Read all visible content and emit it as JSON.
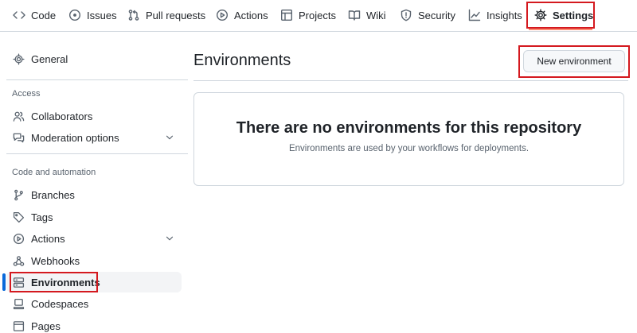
{
  "nav": {
    "tabs": [
      {
        "label": "Code",
        "icon": "code-icon"
      },
      {
        "label": "Issues",
        "icon": "issue-opened-icon"
      },
      {
        "label": "Pull requests",
        "icon": "git-pull-request-icon"
      },
      {
        "label": "Actions",
        "icon": "play-icon"
      },
      {
        "label": "Projects",
        "icon": "table-icon"
      },
      {
        "label": "Wiki",
        "icon": "book-icon"
      },
      {
        "label": "Security",
        "icon": "shield-icon"
      },
      {
        "label": "Insights",
        "icon": "graph-icon"
      },
      {
        "label": "Settings",
        "icon": "gear-icon"
      }
    ],
    "active": "Settings"
  },
  "sidebar": {
    "general": "General",
    "access_title": "Access",
    "access_items": [
      {
        "label": "Collaborators",
        "icon": "people-icon"
      },
      {
        "label": "Moderation options",
        "icon": "comment-discussion-icon",
        "expandable": true
      }
    ],
    "automation_title": "Code and automation",
    "automation_items": [
      {
        "label": "Branches",
        "icon": "git-branch-icon"
      },
      {
        "label": "Tags",
        "icon": "tag-icon"
      },
      {
        "label": "Actions",
        "icon": "play-icon",
        "expandable": true
      },
      {
        "label": "Webhooks",
        "icon": "webhook-icon"
      },
      {
        "label": "Environments",
        "icon": "server-icon",
        "active": true
      },
      {
        "label": "Codespaces",
        "icon": "codespaces-icon"
      },
      {
        "label": "Pages",
        "icon": "browser-icon"
      }
    ]
  },
  "main": {
    "title": "Environments",
    "new_button": "New environment",
    "blankslate": {
      "heading": "There are no environments for this repository",
      "description": "Environments are used by your workflows for deployments."
    }
  },
  "colors": {
    "accent": "#0969da",
    "highlight": "#d4191f",
    "border": "#d0d7de",
    "muted": "#59636e",
    "tab_underline": "#fd8c73"
  }
}
